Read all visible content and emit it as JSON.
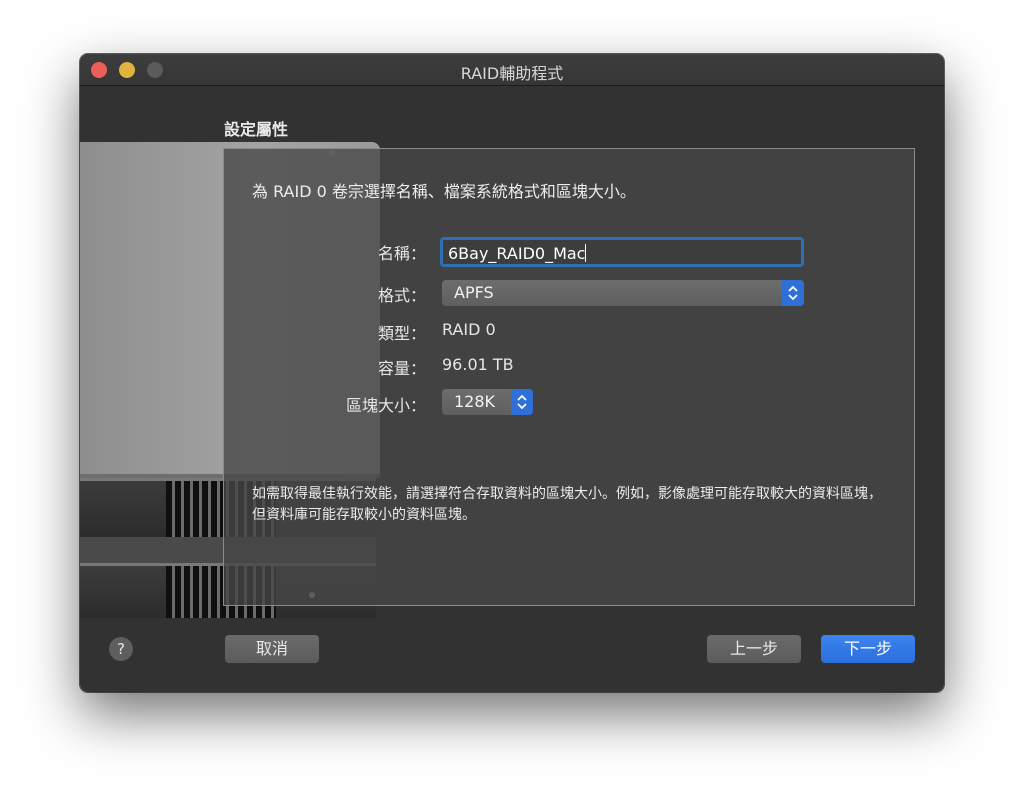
{
  "window": {
    "title": "RAID輔助程式"
  },
  "page": {
    "section_title": "設定屬性",
    "description": "為 RAID 0 卷宗選擇名稱、檔案系統格式和區塊大小。",
    "hint": "如需取得最佳執行效能，請選擇符合存取資料的區塊大小。例如，影像處理可能存取較大的資料區塊，但資料庫可能存取較小的資料區塊。"
  },
  "form": {
    "name_label": "名稱：",
    "name_value": "6Bay_RAID0_Mac",
    "format_label": "格式：",
    "format_value": "APFS",
    "type_label": "類型：",
    "type_value": "RAID 0",
    "capacity_label": "容量：",
    "capacity_value": "96.01 TB",
    "chunk_label": "區塊大小：",
    "chunk_value": "128K"
  },
  "buttons": {
    "help": "?",
    "cancel": "取消",
    "back": "上一步",
    "next": "下一步"
  },
  "colors": {
    "accent": "#2e6fd8",
    "close": "#ec5f58",
    "minimize": "#e1b33a"
  }
}
